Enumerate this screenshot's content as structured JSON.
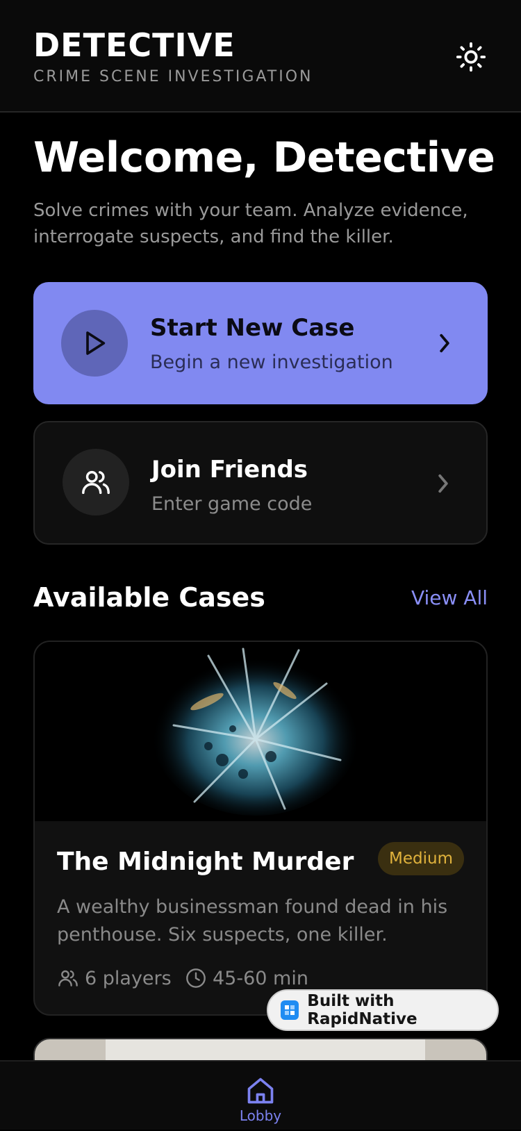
{
  "header": {
    "title": "DETECTIVE",
    "subtitle": "CRIME SCENE INVESTIGATION",
    "theme_icon": "sun-icon"
  },
  "welcome": {
    "title": "Welcome, Detective",
    "description": "Solve crimes with your team. Analyze evidence, interrogate suspects, and find the killer."
  },
  "actions": {
    "start": {
      "title": "Start New Case",
      "subtitle": "Begin a new investigation",
      "icon": "play-icon",
      "color": "#8189f1"
    },
    "join": {
      "title": "Join Friends",
      "subtitle": "Enter game code",
      "icon": "users-icon"
    }
  },
  "cases_section": {
    "title": "Available Cases",
    "view_all": "View All"
  },
  "cases": [
    {
      "title": "The Midnight Murder",
      "difficulty": "Medium",
      "description": "A wealthy businessman found dead in his penthouse. Six suspects, one killer.",
      "players": "6 players",
      "duration": "45-60 min"
    }
  ],
  "built_with": "Built with RapidNative",
  "tabbar": {
    "tabs": [
      {
        "label": "Lobby",
        "icon": "home-icon",
        "active": true
      }
    ],
    "accent": "#7c82f0"
  }
}
